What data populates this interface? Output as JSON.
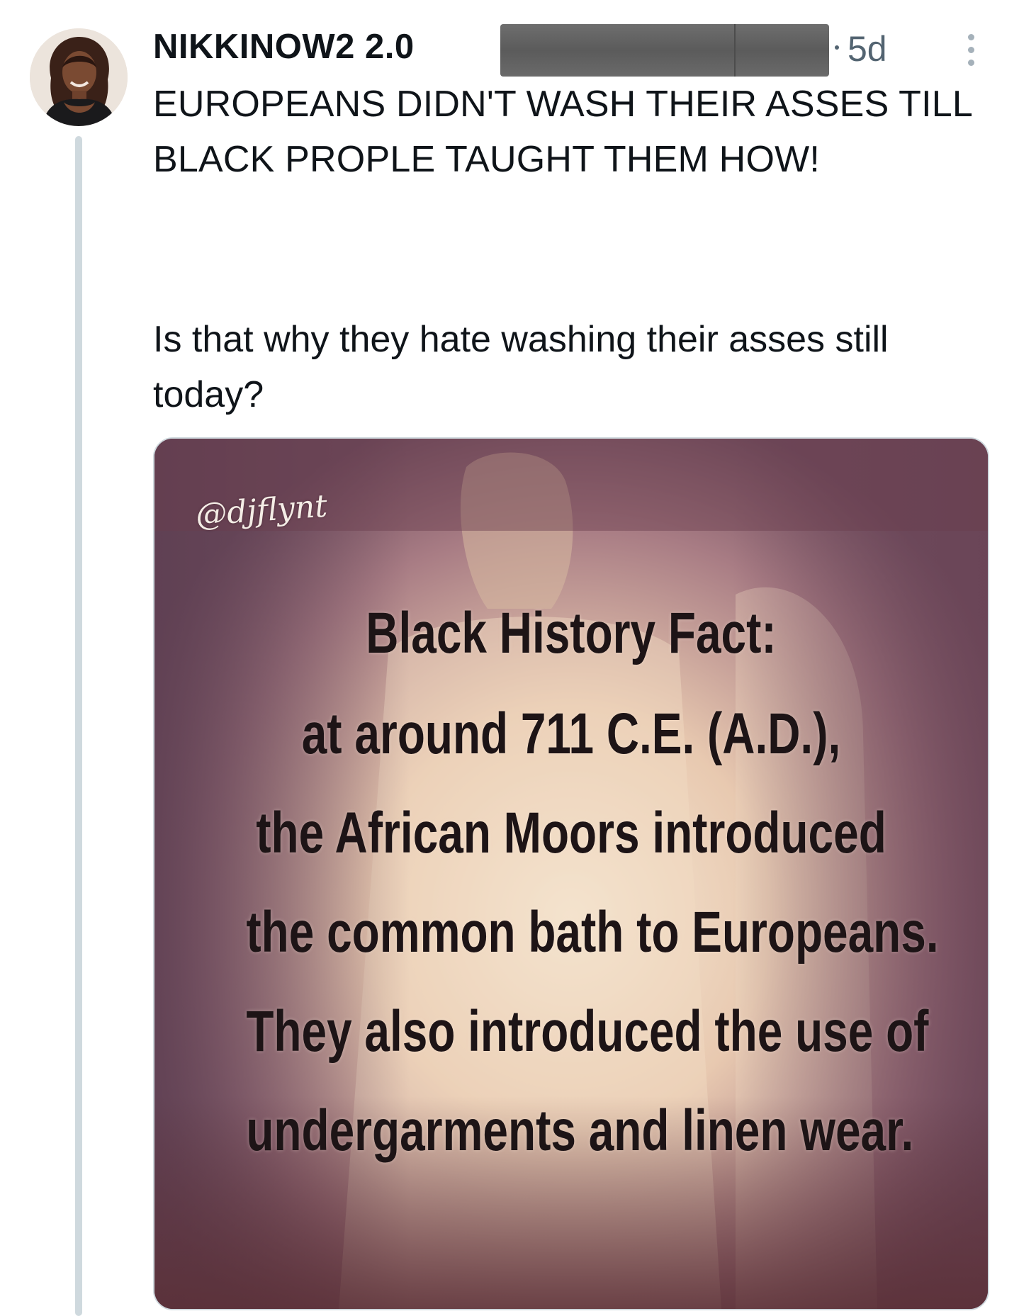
{
  "post": {
    "display_name": "NIKKINOW2 2.0",
    "timestamp": "5d",
    "text_line_1": "EUROPEANS DIDN'T WASH THEIR ASSES TILL BLACK PROPLE TAUGHT THEM HOW!",
    "text_line_2": "Is that why they hate washing their asses still today?"
  },
  "icons": {
    "more": "more-vertical-icon"
  },
  "media": {
    "watermark": "@djflynt",
    "title": "Black History Fact:",
    "lines": [
      "at around 711 C.E. (A.D.),",
      "the African Moors introduced",
      "the common bath to Europeans.",
      "They also introduced the use of",
      "undergarments and linen wear."
    ]
  },
  "colors": {
    "text_primary": "#0f1419",
    "text_secondary": "#536471",
    "thread_line": "#cfd9de",
    "redaction": "#5f5f5f"
  }
}
